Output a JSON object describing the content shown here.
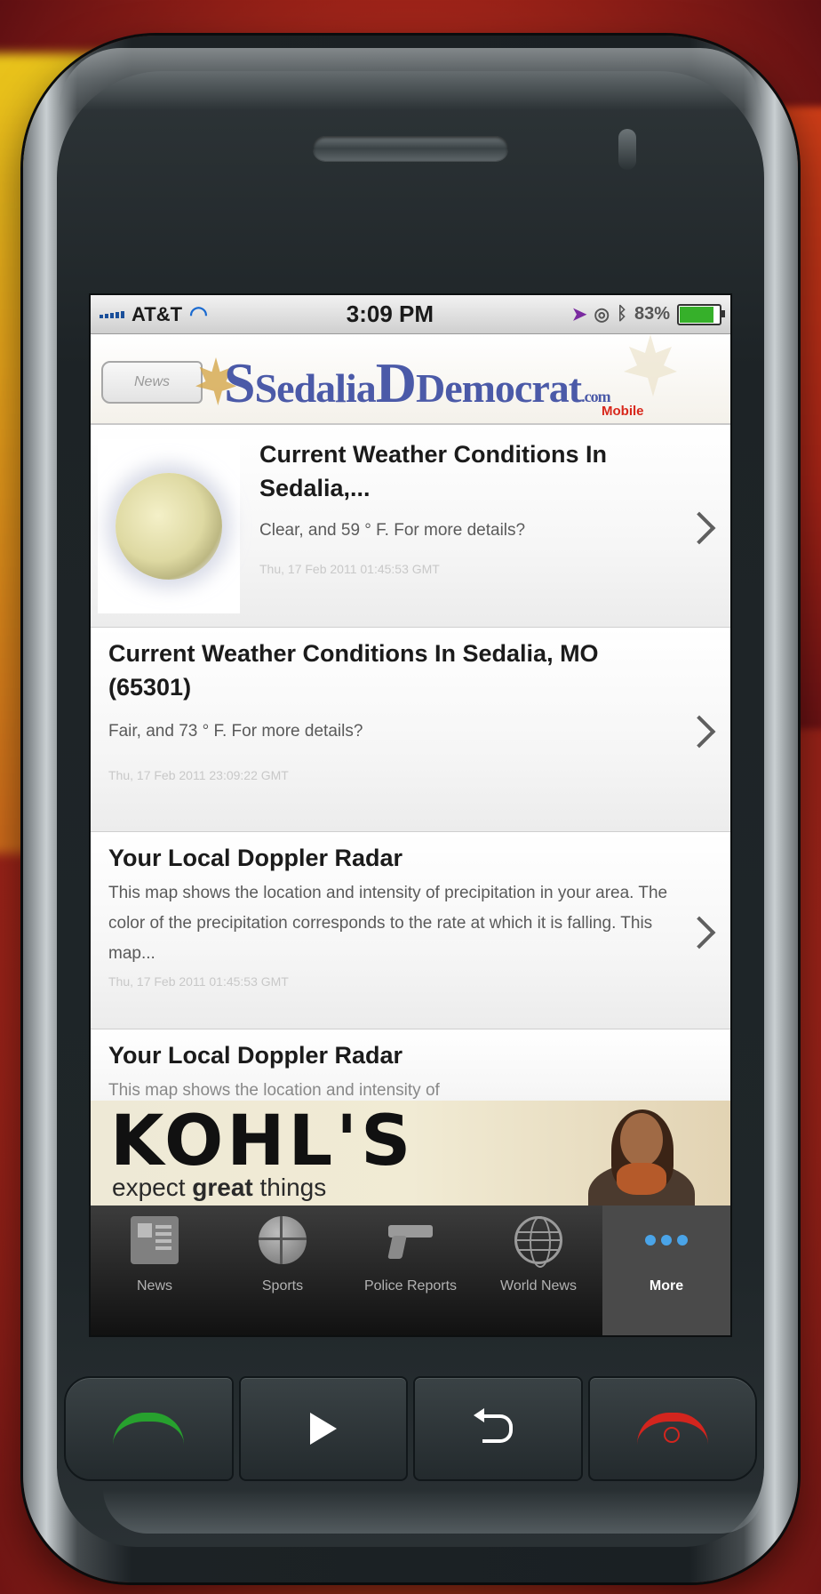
{
  "status_bar": {
    "carrier": "AT&T",
    "time": "3:09 PM",
    "battery": "83%",
    "battery_level": 0.83
  },
  "header": {
    "back_label": "News",
    "logo_part1": "Sedalia",
    "logo_part2": "Democrat",
    "logo_suffix": ".com",
    "logo_mobile": "Mobile"
  },
  "articles": [
    {
      "title": "Current Weather Conditions In Sedalia,...",
      "description": "Clear, and 59 ° F. For more details?",
      "date": "Thu, 17 Feb 2011 01:45:53 GMT"
    },
    {
      "title": "Current Weather Conditions In Sedalia, MO (65301)",
      "description": "Fair, and 73 ° F. For more details?",
      "date": "Thu, 17 Feb 2011 23:09:22 GMT"
    },
    {
      "title": "Your Local Doppler Radar",
      "description": "This map shows the location and intensity of precipitation in your area. The color of the precipitation corresponds to the rate at which it is falling.  This map...",
      "date": "Thu, 17 Feb 2011 01:45:53 GMT"
    },
    {
      "title": "Your Local Doppler Radar",
      "description": "This map shows the location and intensity of"
    }
  ],
  "ad": {
    "brand": "KOHL'S",
    "tag_prefix": "expect ",
    "tag_bold": "great",
    "tag_suffix": " things"
  },
  "tabs": [
    {
      "label": "News",
      "icon": "newspaper-icon"
    },
    {
      "label": "Sports",
      "icon": "basketball-icon"
    },
    {
      "label": "Police Reports",
      "icon": "gun-icon"
    },
    {
      "label": "World News",
      "icon": "globe-icon"
    },
    {
      "label": "More",
      "icon": "more-dots-icon",
      "active": true
    }
  ],
  "colors": {
    "accent_blue": "#4aa4e8",
    "logo_blue": "#4b5aa8",
    "call_green": "#27a12e",
    "end_red": "#d3251e"
  }
}
